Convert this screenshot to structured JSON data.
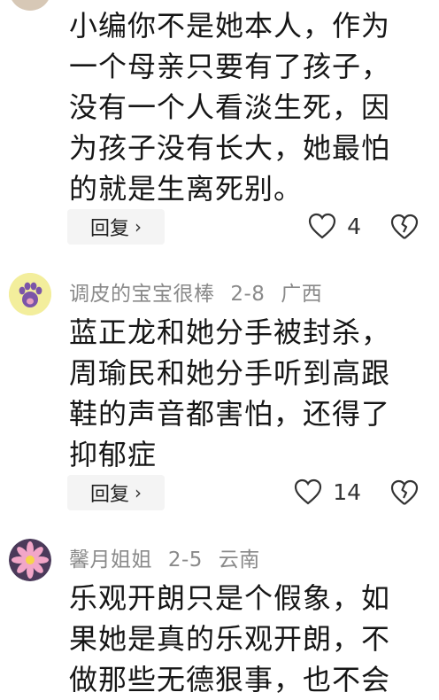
{
  "comments": [
    {
      "author": "",
      "date": "",
      "location": "",
      "lines": [
        "小编你不是她本人，作为",
        "一个母亲只要有了孩子，",
        "没有一个人看淡生死，因",
        "为孩子没有长大，她最怕",
        "的就是生离死别。"
      ],
      "reply_label": "回复",
      "likes": "4"
    },
    {
      "author": "调皮的宝宝很棒",
      "date": "2-8",
      "location": "广西",
      "lines": [
        "蓝正龙和她分手被封杀，",
        "周瑜民和她分手听到高跟",
        "鞋的声音都害怕，还得了",
        "抑郁症"
      ],
      "reply_label": "回复",
      "likes": "14"
    },
    {
      "author": "馨月姐姐",
      "date": "2-5",
      "location": "云南",
      "lines": [
        "乐观开朗只是个假象，如",
        "果她是真的乐观开朗，不",
        "做那些无德狠事，也不会"
      ],
      "reply_label": "",
      "likes": ""
    }
  ],
  "icons": {
    "like": "heart-outline-icon",
    "dislike": "broken-heart-icon",
    "reply_chevron": "chevron-right-icon"
  }
}
